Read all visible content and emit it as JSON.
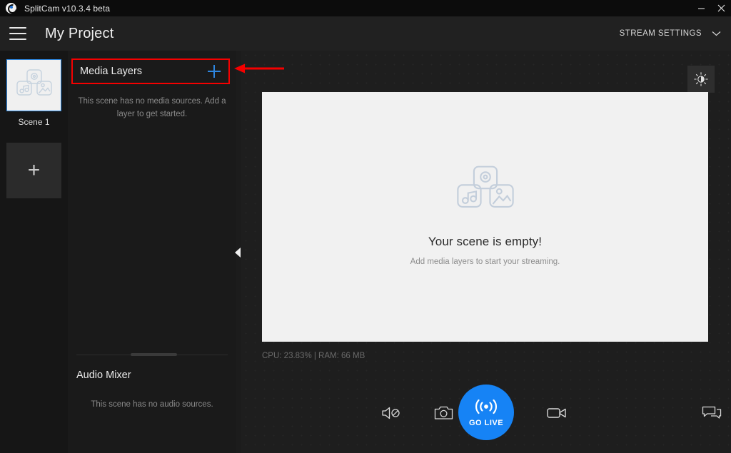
{
  "titlebar": {
    "app_name": "SplitCam v10.3.4 beta",
    "logo_icon": "splitcam-logo-icon",
    "minimize_icon": "minimize-icon",
    "close_icon": "close-icon"
  },
  "header": {
    "menu_icon": "hamburger-menu-icon",
    "project_title": "My Project",
    "stream_settings_label": "STREAM SETTINGS",
    "stream_settings_chevron_icon": "chevron-down-icon"
  },
  "scenes": {
    "thumbnail_icon": "media-placeholder-icon",
    "label": "Scene 1",
    "add_scene_label": "+"
  },
  "layers_panel": {
    "media_layers_title": "Media Layers",
    "add_layer_icon": "plus-icon",
    "empty_text": "This scene has no media sources. Add a layer to get started.",
    "audio_mixer_title": "Audio Mixer",
    "audio_empty_text": "This scene has no audio sources.",
    "collapse_icon": "collapse-left-triangle-icon"
  },
  "stage": {
    "brightness_icon": "brightness-icon",
    "preview_placeholder_icon": "media-placeholder-icon",
    "empty_title": "Your scene is empty!",
    "empty_subtitle": "Add media layers to start your streaming.",
    "resource_stats": "CPU: 23.83% | RAM: 66 MB"
  },
  "toolbar": {
    "mute_audio_icon": "speaker-muted-icon",
    "snapshot_icon": "camera-icon",
    "go_live_icon": "broadcast-icon",
    "go_live_label": "GO LIVE",
    "record_icon": "video-camera-icon",
    "chat_icon": "chat-bubbles-icon"
  },
  "annotation": {
    "highlight_color": "#f50000",
    "arrow_icon": "red-arrow-left-icon"
  },
  "colors": {
    "accent_blue": "#1683f5",
    "plus_blue": "#2e86e0",
    "titlebar_bg": "#0c0c0c",
    "header_bg": "#212121",
    "panel_bg": "#1a1a1a",
    "rail_bg": "#161616",
    "stage_bg": "#1e1e1e",
    "preview_bg": "#f1f1f1",
    "annotation_red": "#f50000"
  }
}
